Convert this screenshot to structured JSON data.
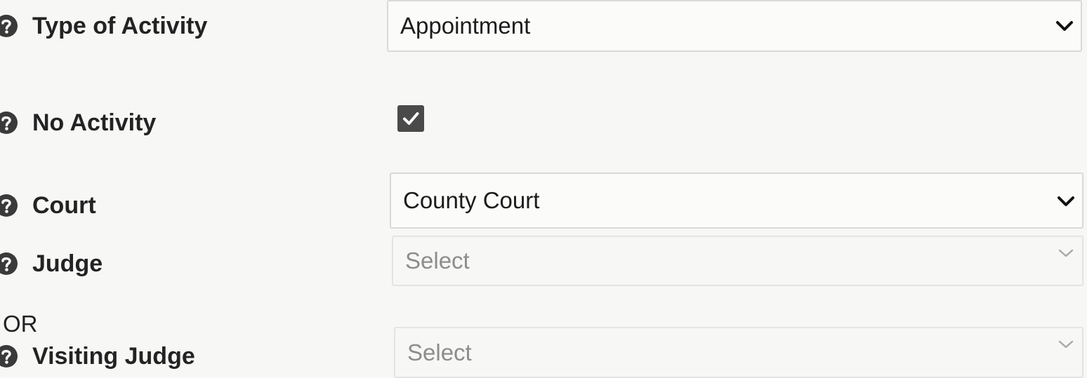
{
  "fields": {
    "type_of_activity": {
      "label": "Type of Activity",
      "value": "Appointment"
    },
    "no_activity": {
      "label": "No Activity",
      "checked": true
    },
    "court": {
      "label": "Court",
      "value": "County Court"
    },
    "judge": {
      "label": "Judge",
      "value": "Select"
    },
    "separator": "OR",
    "visiting_judge": {
      "label": "Visiting Judge",
      "value": "Select"
    }
  },
  "icons": {
    "help": "help-circle-icon",
    "dropdown": "chevron-down-icon",
    "check": "checkmark-icon"
  },
  "colors": {
    "background": "#f7f7f6",
    "label": "#232323",
    "placeholder": "#8d8d8d",
    "checkbox": "#4a4a4a"
  }
}
